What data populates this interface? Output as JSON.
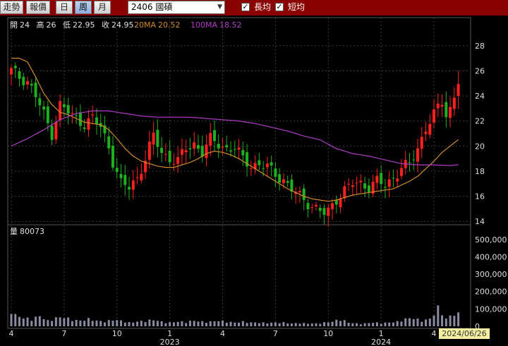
{
  "toolbar": {
    "tabs": [
      {
        "label": "走勢",
        "active": false
      },
      {
        "label": "報價",
        "active": false
      },
      {
        "label": "日",
        "active": false
      },
      {
        "label": "周",
        "active": true
      },
      {
        "label": "月",
        "active": false
      }
    ],
    "symbol": "2406 國碩",
    "long_ma_label": "長均",
    "long_ma_checked": true,
    "short_ma_label": "短均",
    "short_ma_checked": true
  },
  "colors": {
    "toolbar_bg": "#8b0000",
    "up": "#ff2020",
    "down": "#1fb01f",
    "ma20": "#d08a2c",
    "ma100": "#b23cc8",
    "volume": "#8a8aa0",
    "grid": "#3a3a3a",
    "cursor_label_bg": "#f5f0a0"
  },
  "chart_data": {
    "type": "candlestick",
    "info": {
      "open_label": "開",
      "open": "24",
      "high_label": "高",
      "high": "26",
      "low_label": "低",
      "low": "22.95",
      "close_label": "收",
      "close": "24.95",
      "ma20_label": "20MA",
      "ma20": "20.52",
      "ma100_label": "100MA",
      "ma100": "18.52"
    },
    "price_axis": {
      "ylim": [
        13,
        29
      ],
      "ticks": [
        14,
        16,
        18,
        20,
        22,
        24,
        26,
        28
      ]
    },
    "volume_axis": {
      "ylim": [
        0,
        560000
      ],
      "ticks": [
        "0",
        "100,000",
        "200,000",
        "300,000",
        "400,000",
        "500,000"
      ],
      "tick_values": [
        0,
        100000,
        200000,
        300000,
        400000,
        500000
      ]
    },
    "volume_label": "量",
    "volume_value": "80073",
    "x_ticks": [
      {
        "label": "4",
        "week": 0
      },
      {
        "label": "7",
        "week": 13
      },
      {
        "label": "10",
        "week": 26
      },
      {
        "label": "1",
        "week": 39
      },
      {
        "label": "4",
        "week": 52
      },
      {
        "label": "7",
        "week": 65
      },
      {
        "label": "10",
        "week": 78
      },
      {
        "label": "1",
        "week": 91
      },
      {
        "label": "4",
        "week": 104
      }
    ],
    "year_labels": [
      {
        "label": "2023",
        "week": 39
      },
      {
        "label": "2024",
        "week": 91
      }
    ],
    "cursor_date": "2024/06/26",
    "price_anchors": [
      [
        0,
        26
      ],
      [
        2,
        25.5
      ],
      [
        4,
        25.2
      ],
      [
        6,
        24
      ],
      [
        8,
        22.5
      ],
      [
        10,
        21
      ],
      [
        12,
        23.3
      ],
      [
        15,
        22.4
      ],
      [
        18,
        21.8
      ],
      [
        20,
        22.2
      ],
      [
        22,
        21.5
      ],
      [
        24,
        20
      ],
      [
        25,
        18.8
      ],
      [
        27,
        17
      ],
      [
        29,
        16.7
      ],
      [
        31,
        17.5
      ],
      [
        33,
        19
      ],
      [
        35,
        20.8
      ],
      [
        37,
        19.5
      ],
      [
        39,
        19
      ],
      [
        41,
        18.8
      ],
      [
        43,
        19.8
      ],
      [
        45,
        20.2
      ],
      [
        47,
        19.5
      ],
      [
        49,
        20.5
      ],
      [
        51,
        20.2
      ],
      [
        53,
        19.8
      ],
      [
        55,
        19.8
      ],
      [
        57,
        19
      ],
      [
        59,
        18.5
      ],
      [
        61,
        18.5
      ],
      [
        63,
        18.3
      ],
      [
        65,
        17.8
      ],
      [
        67,
        17.3
      ],
      [
        69,
        16.5
      ],
      [
        71,
        16
      ],
      [
        73,
        15.5
      ],
      [
        75,
        15
      ],
      [
        77,
        14.6
      ],
      [
        78,
        14.8
      ],
      [
        80,
        15.8
      ],
      [
        82,
        16.5
      ],
      [
        84,
        17
      ],
      [
        86,
        17
      ],
      [
        88,
        16.8
      ],
      [
        90,
        17.2
      ],
      [
        92,
        16.8
      ],
      [
        94,
        17.5
      ],
      [
        96,
        18.3
      ],
      [
        98,
        18.5
      ],
      [
        100,
        19.8
      ],
      [
        102,
        21.5
      ],
      [
        104,
        22.5
      ],
      [
        106,
        23.5
      ],
      [
        107,
        22.5
      ],
      [
        108,
        23
      ],
      [
        109,
        24
      ],
      [
        110,
        24.95
      ]
    ],
    "ma20": [
      [
        0,
        27
      ],
      [
        2,
        27
      ],
      [
        4,
        26.7
      ],
      [
        6,
        25.5
      ],
      [
        8,
        24.2
      ],
      [
        10,
        23.3
      ],
      [
        12,
        22.7
      ],
      [
        14,
        22.5
      ],
      [
        16,
        22.2
      ],
      [
        18,
        21.9
      ],
      [
        20,
        21.8
      ],
      [
        22,
        21.7
      ],
      [
        24,
        21.3
      ],
      [
        26,
        20.6
      ],
      [
        28,
        19.8
      ],
      [
        30,
        19.2
      ],
      [
        32,
        18.8
      ],
      [
        34,
        18.6
      ],
      [
        36,
        18.4
      ],
      [
        38,
        18.3
      ],
      [
        40,
        18.3
      ],
      [
        42,
        18.5
      ],
      [
        44,
        18.7
      ],
      [
        46,
        19
      ],
      [
        48,
        19.4
      ],
      [
        50,
        19.6
      ],
      [
        52,
        19.5
      ],
      [
        54,
        19.3
      ],
      [
        56,
        19
      ],
      [
        58,
        18.6
      ],
      [
        60,
        18.2
      ],
      [
        62,
        17.8
      ],
      [
        64,
        17.4
      ],
      [
        66,
        17
      ],
      [
        68,
        16.6
      ],
      [
        70,
        16.3
      ],
      [
        72,
        16
      ],
      [
        74,
        15.8
      ],
      [
        76,
        15.7
      ],
      [
        78,
        15.6
      ],
      [
        80,
        15.7
      ],
      [
        82,
        15.9
      ],
      [
        84,
        16.1
      ],
      [
        86,
        16.2
      ],
      [
        88,
        16.3
      ],
      [
        90,
        16.4
      ],
      [
        92,
        16.5
      ],
      [
        94,
        16.6
      ],
      [
        96,
        16.9
      ],
      [
        98,
        17.2
      ],
      [
        100,
        17.6
      ],
      [
        102,
        18.2
      ],
      [
        104,
        18.8
      ],
      [
        106,
        19.5
      ],
      [
        108,
        20
      ],
      [
        110,
        20.52
      ]
    ],
    "ma100": [
      [
        0,
        20
      ],
      [
        4,
        20.6
      ],
      [
        8,
        21.3
      ],
      [
        12,
        22.1
      ],
      [
        16,
        22.6
      ],
      [
        20,
        22.8
      ],
      [
        24,
        22.8
      ],
      [
        28,
        22.6
      ],
      [
        32,
        22.4
      ],
      [
        36,
        22.3
      ],
      [
        40,
        22.3
      ],
      [
        44,
        22.3
      ],
      [
        48,
        22.2
      ],
      [
        52,
        22.1
      ],
      [
        56,
        22
      ],
      [
        60,
        21.8
      ],
      [
        64,
        21.5
      ],
      [
        68,
        21.2
      ],
      [
        72,
        20.8
      ],
      [
        76,
        20.5
      ],
      [
        80,
        19.8
      ],
      [
        84,
        19.4
      ],
      [
        88,
        19.2
      ],
      [
        92,
        18.9
      ],
      [
        96,
        18.6
      ],
      [
        100,
        18.5
      ],
      [
        104,
        18.5
      ],
      [
        108,
        18.45
      ],
      [
        110,
        18.52
      ]
    ],
    "volume_anchors": [
      [
        0,
        95000
      ],
      [
        1,
        60000
      ],
      [
        3,
        45000
      ],
      [
        5,
        40000
      ],
      [
        7,
        55000
      ],
      [
        9,
        30000
      ],
      [
        11,
        45000
      ],
      [
        13,
        50000
      ],
      [
        15,
        35000
      ],
      [
        17,
        30000
      ],
      [
        19,
        40000
      ],
      [
        21,
        30000
      ],
      [
        23,
        25000
      ],
      [
        25,
        35000
      ],
      [
        27,
        30000
      ],
      [
        29,
        20000
      ],
      [
        31,
        25000
      ],
      [
        33,
        30000
      ],
      [
        35,
        35000
      ],
      [
        37,
        25000
      ],
      [
        39,
        20000
      ],
      [
        41,
        25000
      ],
      [
        43,
        25000
      ],
      [
        45,
        30000
      ],
      [
        47,
        25000
      ],
      [
        49,
        25000
      ],
      [
        51,
        30000
      ],
      [
        53,
        25000
      ],
      [
        55,
        20000
      ],
      [
        57,
        25000
      ],
      [
        59,
        20000
      ],
      [
        61,
        20000
      ],
      [
        63,
        18000
      ],
      [
        65,
        20000
      ],
      [
        67,
        20000
      ],
      [
        69,
        15000
      ],
      [
        71,
        18000
      ],
      [
        73,
        15000
      ],
      [
        75,
        15000
      ],
      [
        77,
        20000
      ],
      [
        79,
        25000
      ],
      [
        81,
        40000
      ],
      [
        83,
        20000
      ],
      [
        85,
        15000
      ],
      [
        87,
        15000
      ],
      [
        89,
        20000
      ],
      [
        91,
        18000
      ],
      [
        93,
        20000
      ],
      [
        95,
        25000
      ],
      [
        97,
        40000
      ],
      [
        99,
        45000
      ],
      [
        101,
        30000
      ],
      [
        103,
        40000
      ],
      [
        105,
        100000
      ],
      [
        107,
        40000
      ],
      [
        109,
        70000
      ],
      [
        110,
        80073
      ]
    ]
  }
}
